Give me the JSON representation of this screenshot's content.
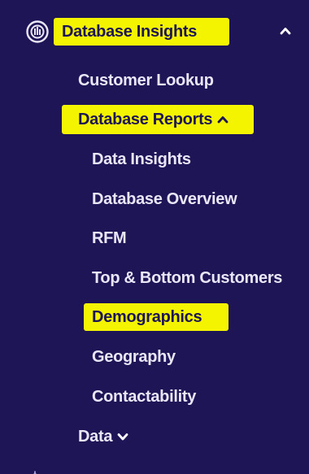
{
  "nav": {
    "section": {
      "label": "Database Insights",
      "icon": "gauge-icon",
      "chevron": "chevron-up-icon"
    },
    "items": [
      {
        "label": "Customer Lookup"
      },
      {
        "label": "Database Reports",
        "chevron": "chevron-up-icon"
      },
      {
        "label": "Data Insights"
      },
      {
        "label": "Database Overview"
      },
      {
        "label": "RFM"
      },
      {
        "label": "Top & Bottom Customers"
      },
      {
        "label": "Demographics"
      },
      {
        "label": "Geography"
      },
      {
        "label": "Contactability"
      },
      {
        "label": "Data",
        "chevron": "chevron-down-icon"
      }
    ]
  },
  "colors": {
    "background": "#1e1557",
    "text": "#e9e6f7",
    "highlight": "#f4f400"
  }
}
